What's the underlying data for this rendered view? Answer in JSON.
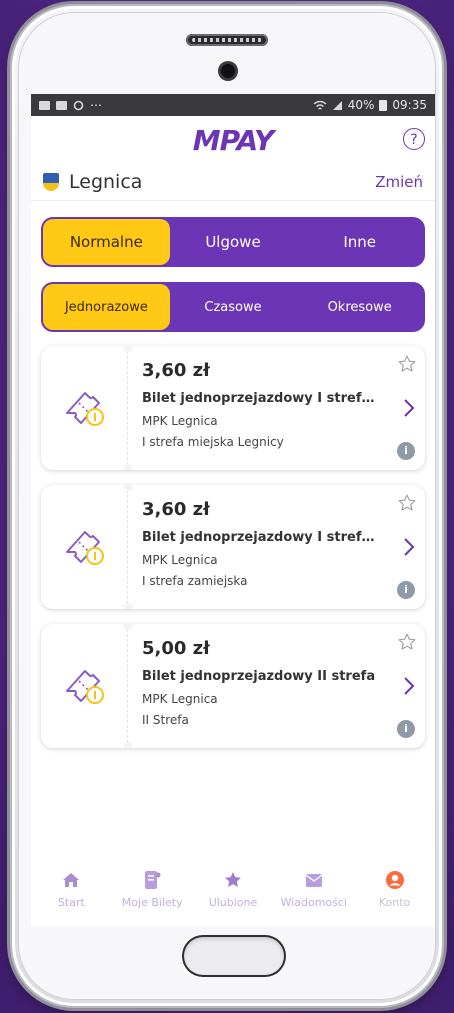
{
  "status_bar": {
    "battery": "40%",
    "time": "09:35",
    "more": "⋯"
  },
  "app": {
    "logo": "MPAY",
    "help_label": "?"
  },
  "city": {
    "name": "Legnica",
    "change_label": "Zmień"
  },
  "fare_types": [
    "Normalne",
    "Ulgowe",
    "Inne"
  ],
  "ticket_types": [
    "Jednorazowe",
    "Czasowe",
    "Okresowe"
  ],
  "tickets": [
    {
      "price": "3,60 zł",
      "name": "Bilet jednoprzejazdowy I strefa mi…",
      "carrier": "MPK Legnica",
      "zone": "I strefa miejska Legnicy"
    },
    {
      "price": "3,60 zł",
      "name": "Bilet jednoprzejazdowy I strefa za…",
      "carrier": "MPK Legnica",
      "zone": "I strefa zamiejska"
    },
    {
      "price": "5,00 zł",
      "name": "Bilet jednoprzejazdowy II strefa",
      "carrier": "MPK Legnica",
      "zone": "II Strefa"
    }
  ],
  "info_label": "i",
  "nav": [
    "Start",
    "Moje Bilety",
    "Ulubione",
    "Wiadomości",
    "Konto"
  ],
  "colors": {
    "purple": "#6c35b5",
    "yellow": "#ffc915",
    "konto_orange": "#ff6a3d"
  },
  "icons": [
    "image-icon",
    "message-icon",
    "sync-icon",
    "wifi-icon",
    "signal-icon",
    "battery-icon",
    "help-icon",
    "city-crest-icon",
    "ticket-icon",
    "star-icon",
    "chevron-right-icon",
    "info-icon",
    "home-icon",
    "tickets-icon",
    "favorites-star-icon",
    "mail-icon",
    "account-icon"
  ]
}
